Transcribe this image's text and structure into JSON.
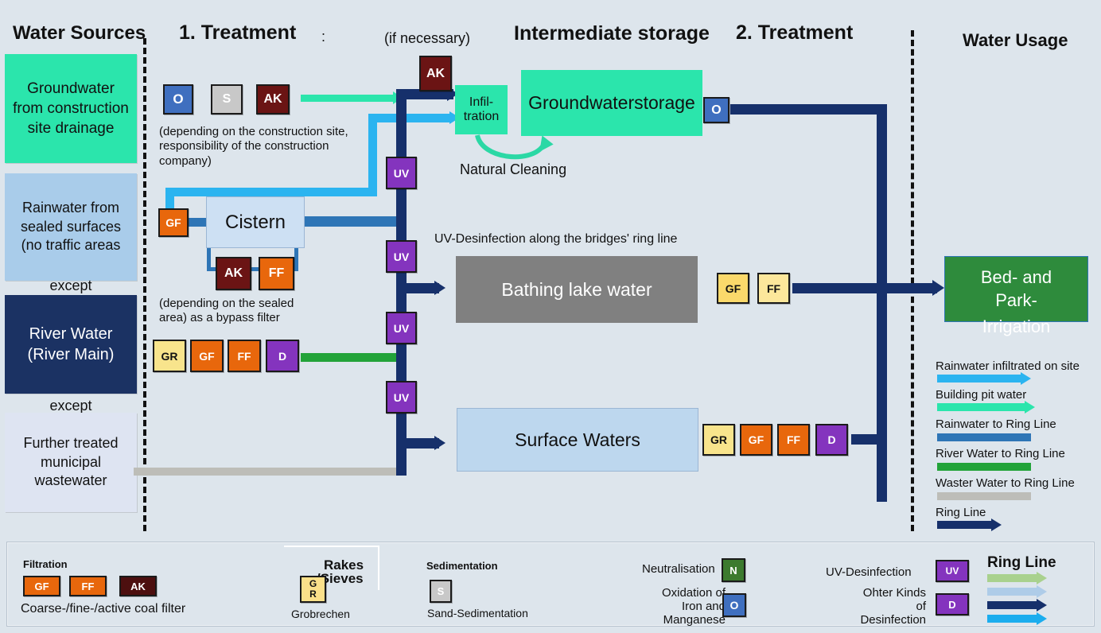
{
  "headers": {
    "water_sources": "Water Sources",
    "treatment1": "1. Treatment",
    "treatment1_colon": ":",
    "if_necessary": "(if necessary)",
    "intermediate_storage": "Intermediate storage",
    "treatment2": "2. Treatment",
    "water_usage": "Water Usage"
  },
  "sources": [
    {
      "label": "Groundwater from construction site drainage",
      "color": "#2BE5AC",
      "text_color": "#111111"
    },
    {
      "label": "Rainwater from sealed surfaces (no traffic areas",
      "overflow": "except",
      "color": "#A9CCEA",
      "text_color": "#111111"
    },
    {
      "label": "River Water (River Main)",
      "overflow": "except",
      "color": "#1B3263",
      "text_color": "#ffffff"
    },
    {
      "label": "Further treated municipal wastewater",
      "color": "#DEE4F2",
      "text_color": "#111111"
    }
  ],
  "treatment1": {
    "gw_chips": [
      {
        "label": "O",
        "color": "#3F6FBF",
        "text_color": "#ffffff"
      },
      {
        "label": "S",
        "color": "#C8C8C8",
        "text_color": "#ffffff"
      },
      {
        "label": "AK",
        "color": "#6B1414",
        "text_color": "#ffffff"
      }
    ],
    "gw_note": "(depending on the construction site, responsibility of the construction company)",
    "ak_top": {
      "label": "AK",
      "color": "#6B1414",
      "text_color": "#ffffff"
    },
    "gf_cistern": {
      "label": "GF",
      "color": "#E8670C",
      "text_color": "#ffffff"
    },
    "cistern_label": "Cistern",
    "cistern_sub": [
      {
        "label": "AK",
        "color": "#6B1414",
        "text_color": "#ffffff"
      },
      {
        "label": "FF",
        "color": "#E8670C",
        "text_color": "#ffffff"
      }
    ],
    "bypass_note": "(depending on the sealed area) as a bypass filter",
    "river_chain": [
      {
        "label": "GR",
        "color": "#F8E48C",
        "text_color": "#111111"
      },
      {
        "label": "GF",
        "color": "#E8670C",
        "text_color": "#ffffff"
      },
      {
        "label": "FF",
        "color": "#E8670C",
        "text_color": "#ffffff"
      },
      {
        "label": "D",
        "color": "#8434BE",
        "text_color": "#ffffff"
      }
    ],
    "uv_chips": [
      {
        "label": "UV",
        "color": "#8434BE",
        "text_color": "#ffffff"
      },
      {
        "label": "UV",
        "color": "#8434BE",
        "text_color": "#ffffff"
      },
      {
        "label": "UV",
        "color": "#8434BE",
        "text_color": "#ffffff"
      },
      {
        "label": "UV",
        "color": "#8434BE",
        "text_color": "#ffffff"
      }
    ]
  },
  "storage": {
    "infiltration": "Infil-\ntration",
    "infiltration_line1": "Infil-",
    "infiltration_line2": "tration",
    "natural_cleaning": "Natural Cleaning",
    "groundwater_storage": "Groundwaterstorage",
    "gw_out_chip": {
      "label": "O",
      "color": "#3F6FBF",
      "text_color": "#ffffff"
    },
    "uv_ringline_note": "UV-Desinfection along the bridges' ring line",
    "bathing_lake": "Bathing lake water",
    "surface_waters": "Surface Waters"
  },
  "treatment2": {
    "lake_chain": [
      {
        "label": "GF",
        "color": "#FBD96B",
        "text_color": "#111111"
      },
      {
        "label": "FF",
        "color": "#FCE79B",
        "text_color": "#111111"
      }
    ],
    "surface_chain": [
      {
        "label": "GR",
        "color": "#F8E48C",
        "text_color": "#111111"
      },
      {
        "label": "GF",
        "color": "#E8670C",
        "text_color": "#ffffff"
      },
      {
        "label": "FF",
        "color": "#E8670C",
        "text_color": "#ffffff"
      },
      {
        "label": "D",
        "color": "#8434BE",
        "text_color": "#ffffff"
      }
    ]
  },
  "usage": {
    "irrigation_line1": "Bed- and",
    "irrigation_line2": "Park-",
    "irrigation_line3": "Irrigation",
    "box_color": "#2E8B3C"
  },
  "flow_legend": [
    {
      "label": "Rainwater infiltrated on site",
      "color": "#2BB4F0",
      "arrow": true
    },
    {
      "label": "Building pit water",
      "color": "#2BE5AC",
      "arrow": true
    },
    {
      "label": "Rainwater to Ring Line",
      "color": "#2E75B6",
      "arrow": false
    },
    {
      "label": "River Water to Ring Line",
      "color": "#22A339",
      "arrow": false
    },
    {
      "label": "Waster Water to Ring Line",
      "color": "#BDBDB8",
      "arrow": false
    },
    {
      "label": "Ring Line",
      "color": "#16306B",
      "arrow": true
    }
  ],
  "bottom_legend": {
    "filtration": {
      "title": "Filtration",
      "chips": [
        {
          "label": "GF",
          "color": "#E8670C",
          "text_color": "#ffffff"
        },
        {
          "label": "FF",
          "color": "#E8670C",
          "text_color": "#ffffff"
        },
        {
          "label": "AK",
          "color": "#4D0F0F",
          "text_color": "#ffffff"
        }
      ],
      "caption": "Coarse-/fine-/active coal filter"
    },
    "rakes": {
      "title": "Rakes\n/Sieves",
      "title_line1": "Rakes",
      "title_line2": "/Sieves",
      "chip": {
        "label_line1": "G",
        "label_line2": "R",
        "color": "#FBE08A",
        "text_color": "#111111"
      },
      "caption": "Grobrechen"
    },
    "sedimentation": {
      "title": "Sedimentation",
      "chip": {
        "label": "S",
        "color": "#C8C8C8",
        "text_color": "#ffffff"
      },
      "caption": "Sand-Sedimentation"
    },
    "chemical": [
      {
        "label": "Neutralisation",
        "chip": {
          "label": "N",
          "color": "#3C7A2E",
          "text_color": "#ffffff"
        }
      },
      {
        "label": "Oxidation of Iron and Manganese",
        "label_line1": "Oxidation of",
        "label_line2": "Iron and",
        "label_line3": "Manganese",
        "chip": {
          "label": "O",
          "color": "#3F6FBF",
          "text_color": "#ffffff"
        }
      }
    ],
    "disinfection": [
      {
        "label": "UV-Desinfection",
        "chip": {
          "label": "UV",
          "color": "#8434BE",
          "text_color": "#ffffff"
        }
      },
      {
        "label": "Ohter Kinds of Desinfection",
        "label_line1": "Ohter Kinds",
        "label_line2": "of",
        "label_line3": "Desinfection",
        "chip": {
          "label": "D",
          "color": "#8434BE",
          "text_color": "#ffffff"
        }
      }
    ],
    "ringline": {
      "title": "Ring Line",
      "arrows": [
        {
          "color": "#A9D18E",
          "arrow": true
        },
        {
          "color": "#AECCE8",
          "arrow": true
        },
        {
          "color": "#16306B",
          "arrow": true
        },
        {
          "color": "#1BADEE",
          "arrow": true
        }
      ]
    }
  }
}
